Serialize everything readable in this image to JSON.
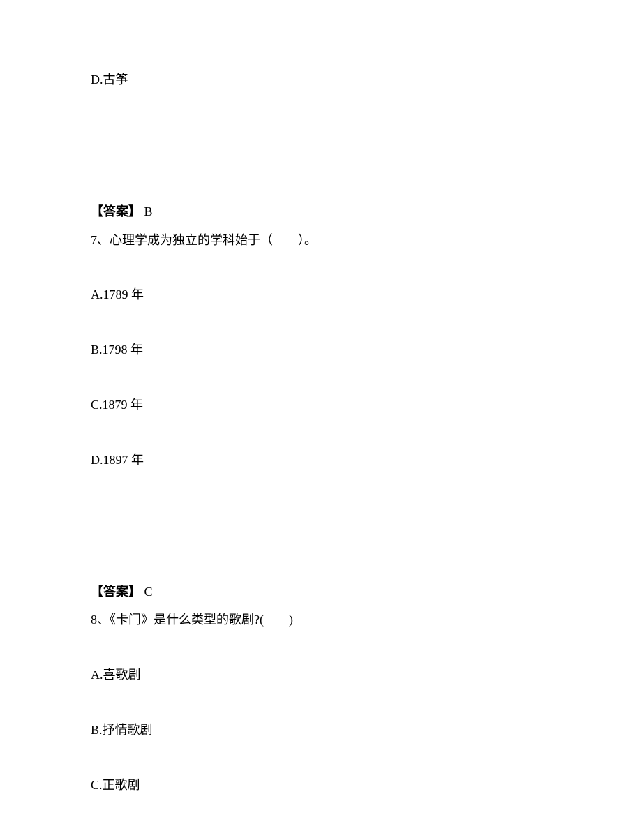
{
  "prev_option_d": "D.古筝",
  "answer6_label": "【答案】",
  "answer6_value": "B",
  "q7": {
    "text": "7、心理学成为独立的学科始于（　　）。",
    "a": "A.1789 年",
    "b": "B.1798 年",
    "c": "C.1879 年",
    "d": "D.1897 年"
  },
  "answer7_label": "【答案】",
  "answer7_value": "C",
  "q8": {
    "text": "8、《卡门》是什么类型的歌剧?(　　)",
    "a": "A.喜歌剧",
    "b": "B.抒情歌剧",
    "c": "C.正歌剧"
  }
}
